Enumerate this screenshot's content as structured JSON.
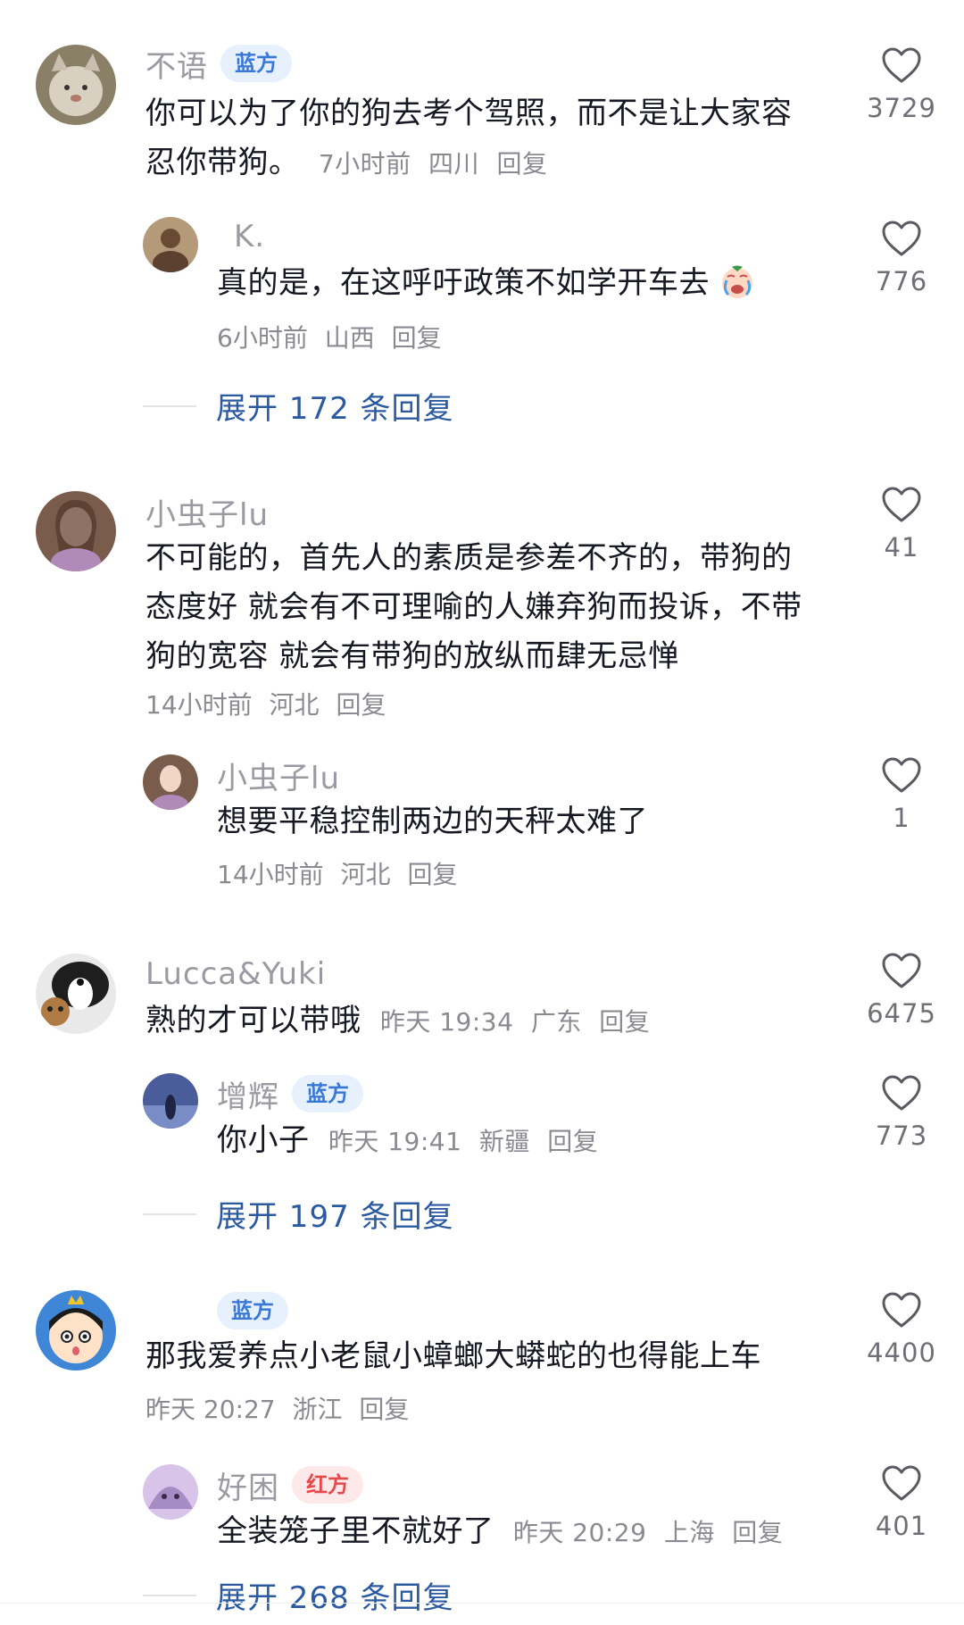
{
  "comments": [
    {
      "name": "不语",
      "badge": "蓝方",
      "text_line1": "你可以为了你的狗去考个驾照，而不是让大家容",
      "text_line2": "忍你带狗。",
      "time": "7小时前",
      "location": "四川",
      "reply_label": "回复",
      "likes": "3729",
      "replies": [
        {
          "name": "K.",
          "text": "真的是，在这呼吁政策不如学开车去",
          "emoji_icon": "crying-face-icon",
          "time": "6小时前",
          "location": "山西",
          "reply_label": "回复",
          "likes": "776"
        }
      ],
      "expand_label": "展开 172 条回复"
    },
    {
      "name": "小虫子lu",
      "text_line1": "不可能的，首先人的素质是参差不齐的，带狗的",
      "text_line2": "态度好 就会有不可理喻的人嫌弃狗而投诉，不带",
      "text_line3": "狗的宽容 就会有带狗的放纵而肆无忌惮",
      "time": "14小时前",
      "location": "河北",
      "reply_label": "回复",
      "likes": "41",
      "replies": [
        {
          "name": "小虫子lu",
          "text": "想要平稳控制两边的天秤太难了",
          "time": "14小时前",
          "location": "河北",
          "reply_label": "回复",
          "likes": "1"
        }
      ]
    },
    {
      "name": "Lucca&Yuki",
      "text": "熟的才可以带哦",
      "time": "昨天 19:34",
      "location": "广东",
      "reply_label": "回复",
      "likes": "6475",
      "replies": [
        {
          "name": "增辉",
          "badge": "蓝方",
          "text": "你小子",
          "time": "昨天 19:41",
          "location": "新疆",
          "reply_label": "回复",
          "likes": "773"
        }
      ],
      "expand_label": "展开 197 条回复"
    },
    {
      "name": "",
      "badge": "蓝方",
      "text": "那我爱养点小老鼠小蟑螂大蟒蛇的也得能上车",
      "time": "昨天 20:27",
      "location": "浙江",
      "reply_label": "回复",
      "likes": "4400",
      "replies": [
        {
          "name": "好困",
          "badge": "红方",
          "text": "全装笼子里不就好了",
          "time": "昨天 20:29",
          "location": "上海",
          "reply_label": "回复",
          "likes": "401"
        }
      ],
      "expand_label": "展开 268 条回复"
    }
  ],
  "colors": {
    "name": "#9a9aa2",
    "text": "#161823",
    "meta": "#8a8a92",
    "expand": "#2c5aa0",
    "badge_blue": "#3a78d6",
    "badge_red": "#e5494b"
  }
}
